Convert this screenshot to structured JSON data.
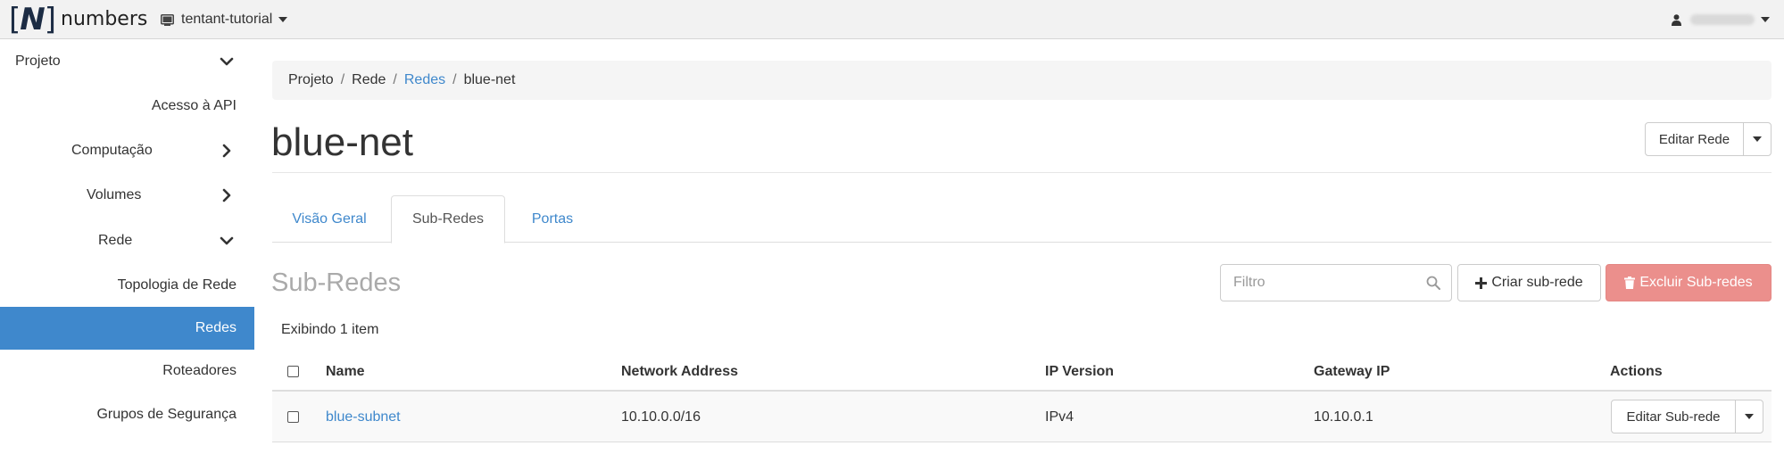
{
  "brand": {
    "mark": "N",
    "text": "numbers"
  },
  "header": {
    "project_name": "tentant-tutorial"
  },
  "sidebar": {
    "items": [
      {
        "label": "Projeto",
        "chevron": "down"
      },
      {
        "label": "Acesso à API"
      },
      {
        "label": "Computação",
        "chevron": "right"
      },
      {
        "label": "Volumes",
        "chevron": "right"
      },
      {
        "label": "Rede",
        "chevron": "down"
      },
      {
        "label": "Topologia de Rede"
      },
      {
        "label": "Redes",
        "active": true
      },
      {
        "label": "Roteadores"
      },
      {
        "label": "Grupos de Segurança"
      }
    ]
  },
  "breadcrumb": [
    "Projeto",
    "Rede",
    "Redes",
    "blue-net"
  ],
  "page": {
    "title": "blue-net",
    "edit_button": "Editar Rede"
  },
  "tabs": [
    {
      "label": "Visão Geral",
      "active": false
    },
    {
      "label": "Sub-Redes",
      "active": true
    },
    {
      "label": "Portas",
      "active": false
    }
  ],
  "section": {
    "title": "Sub-Redes",
    "filter_placeholder": "Filtro",
    "create_button": "Criar sub-rede",
    "delete_button": "Excluir Sub-redes",
    "count_text": "Exibindo 1 item"
  },
  "table": {
    "headers": [
      "Name",
      "Network Address",
      "IP Version",
      "Gateway IP",
      "Actions"
    ],
    "rows": [
      {
        "name": "blue-subnet",
        "network_address": "10.10.0.0/16",
        "ip_version": "IPv4",
        "gateway_ip": "10.10.0.1",
        "action": "Editar Sub-rede"
      }
    ]
  },
  "colors": {
    "accent": "#3f88cc",
    "danger": "#eb8f8c",
    "navbar": "#f2f2f2"
  }
}
